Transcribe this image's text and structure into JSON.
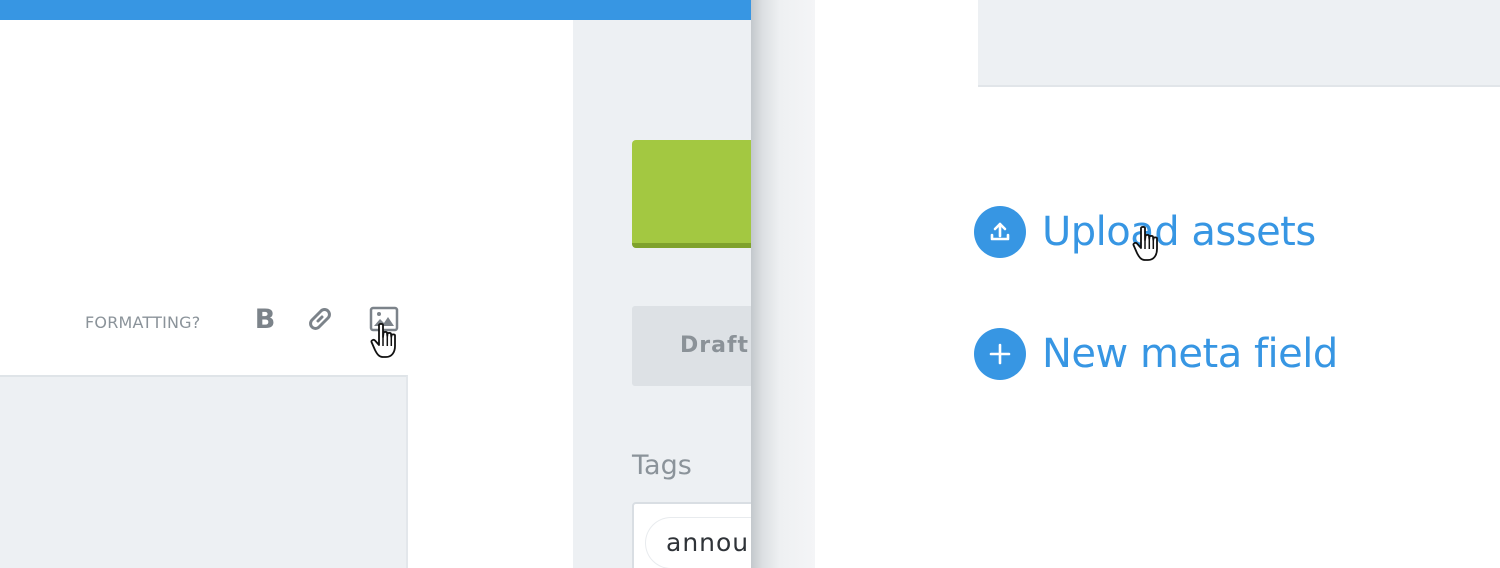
{
  "colors": {
    "accent": "#3796e3",
    "publish_green": "#a3c841",
    "muted_text": "#8b939a",
    "panel_gray": "#edf0f3"
  },
  "editor": {
    "toolbar": {
      "formatting_label": "FORMATTING?",
      "bold_label": "B",
      "bold_icon": "bold-icon",
      "link_icon": "link-icon",
      "image_icon": "image-icon"
    }
  },
  "sidebar": {
    "draft_label": "Draft",
    "tags_label": "Tags",
    "tag_chip": "annou"
  },
  "assets_panel": {
    "upload_label": "Upload assets",
    "upload_icon": "upload-icon",
    "new_meta_label": "New meta field",
    "new_meta_icon": "plus-icon"
  },
  "cursor_icon": "hand-pointer-icon"
}
